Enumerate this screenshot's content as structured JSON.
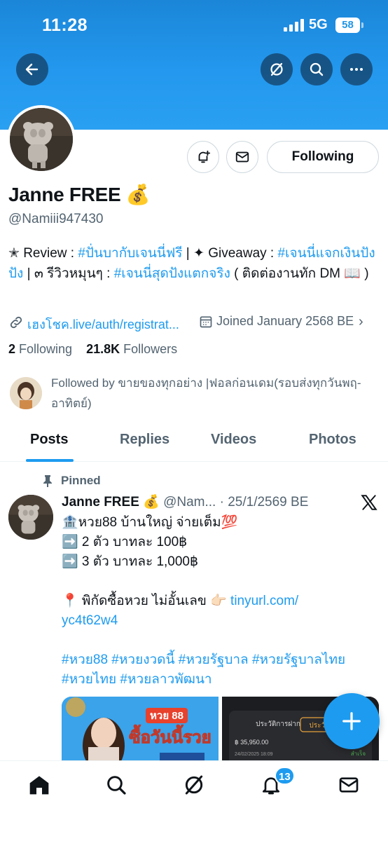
{
  "status_bar": {
    "time": "11:28",
    "network": "5G",
    "battery": "58"
  },
  "header": {
    "back_icon": "back-arrow-icon",
    "grok_icon": "grok-icon",
    "search_icon": "search-icon",
    "more_icon": "more-icon"
  },
  "profile": {
    "name": "Janne FREE 💰",
    "handle": "@Namiii947430",
    "following_button": "Following",
    "bio": {
      "part1": "✭ Review : ",
      "tag1": "#ปั่นบากับเจนนี่ฟรี",
      "part2": " | ✦ Giveaway : ",
      "tag2": "#เจนนี่แจกเงินปังปัง",
      "part3": " | ๓ รีวิวหมุนๆ : ",
      "tag3": "#เจนนี่สุดปังแตกจริง",
      "part4": " ( ติดต่องานทัก DM 📖 )"
    },
    "link": "เฮงโชค.live/auth/registrat...",
    "joined": "Joined January 2568 BE",
    "following_count": "2",
    "following_label": "Following",
    "followers_count": "21.8K",
    "followers_label": "Followers",
    "followed_by": "Followed by ขายของทุกอย่าง |ฟอลก่อนเดม(รอบส่งทุกวันพฤ-อาทิตย์)"
  },
  "tabs": [
    {
      "label": "Posts",
      "active": true
    },
    {
      "label": "Replies",
      "active": false
    },
    {
      "label": "Videos",
      "active": false
    },
    {
      "label": "Photos",
      "active": false
    }
  ],
  "post": {
    "pinned_label": "Pinned",
    "author": "Janne FREE 💰",
    "meta": "@Nam... · 25/1/2569 BE",
    "lines": [
      "🏦หวย88 บ้านใหญ่ จ่ายเต็ม💯",
      "➡️ 2 ตัว บาทละ 100฿",
      "➡️ 3 ตัว บาทละ 1,000฿"
    ],
    "location_text": "📍 พิกัดซื้อหวย ไม่อั้นเลข 👉🏻 ",
    "url_part1": "tinyurl.com/",
    "url_part2": "yc4t62w4",
    "hashtags_line1": "#หวย88 #หวยงวดนี้ #หวยรัฐบาล #หวยรัฐบาลไทย",
    "hashtags_line2": "#หวยไทย #หวยลาวพัฒนา",
    "media1_text": "ซื้อวันนี้รวย",
    "media1_logo": "หวย 88",
    "media2_tab1": "ประวัติการฝาก",
    "media2_tab2": "ประวัติก",
    "media2_amount": "฿ 35,950.00",
    "media2_date": "24/02/2025 18:09",
    "media2_status": "สำเร็จ"
  },
  "bottom_nav": {
    "items": [
      "home-icon",
      "search-icon",
      "grok-icon",
      "notifications-icon",
      "messages-icon"
    ],
    "notification_badge": "13"
  },
  "colors": {
    "accent": "#1d9bf0",
    "banner": "#2398ee",
    "text": "#0f1419",
    "muted": "#536471"
  }
}
